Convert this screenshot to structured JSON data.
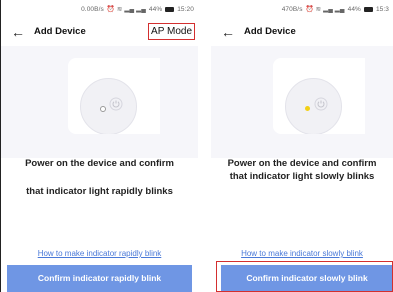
{
  "panels": [
    {
      "status_bar": {
        "net_speed": "0.00B/s",
        "battery_pct": "44%",
        "time": "15:20"
      },
      "header": {
        "back_icon": "arrow-left-icon",
        "title": "Add Device",
        "mode_link": "AP Mode"
      },
      "led_state": "off",
      "instruction": {
        "line1": "Power on the device and confirm",
        "line2": "that indicator light rapidly blinks"
      },
      "help_link": "How to make indicator rapidly blink",
      "confirm_button": "Confirm indicator rapidly blink"
    },
    {
      "status_bar": {
        "net_speed": "470B/s",
        "battery_pct": "44%",
        "time": "15:3"
      },
      "header": {
        "back_icon": "arrow-left-icon",
        "title": "Add Device"
      },
      "led_state": "on",
      "instruction": {
        "line1": "Power on the device and confirm",
        "line2": "that indicator light slowly blinks"
      },
      "help_link": "How to make indicator slowly blink",
      "confirm_button": "Confirm indicator slowly blink"
    }
  ],
  "colors": {
    "accent": "#6f96e4",
    "link": "#4a79d8",
    "highlight": "#d32f2f",
    "led_on": "#f2d016"
  }
}
